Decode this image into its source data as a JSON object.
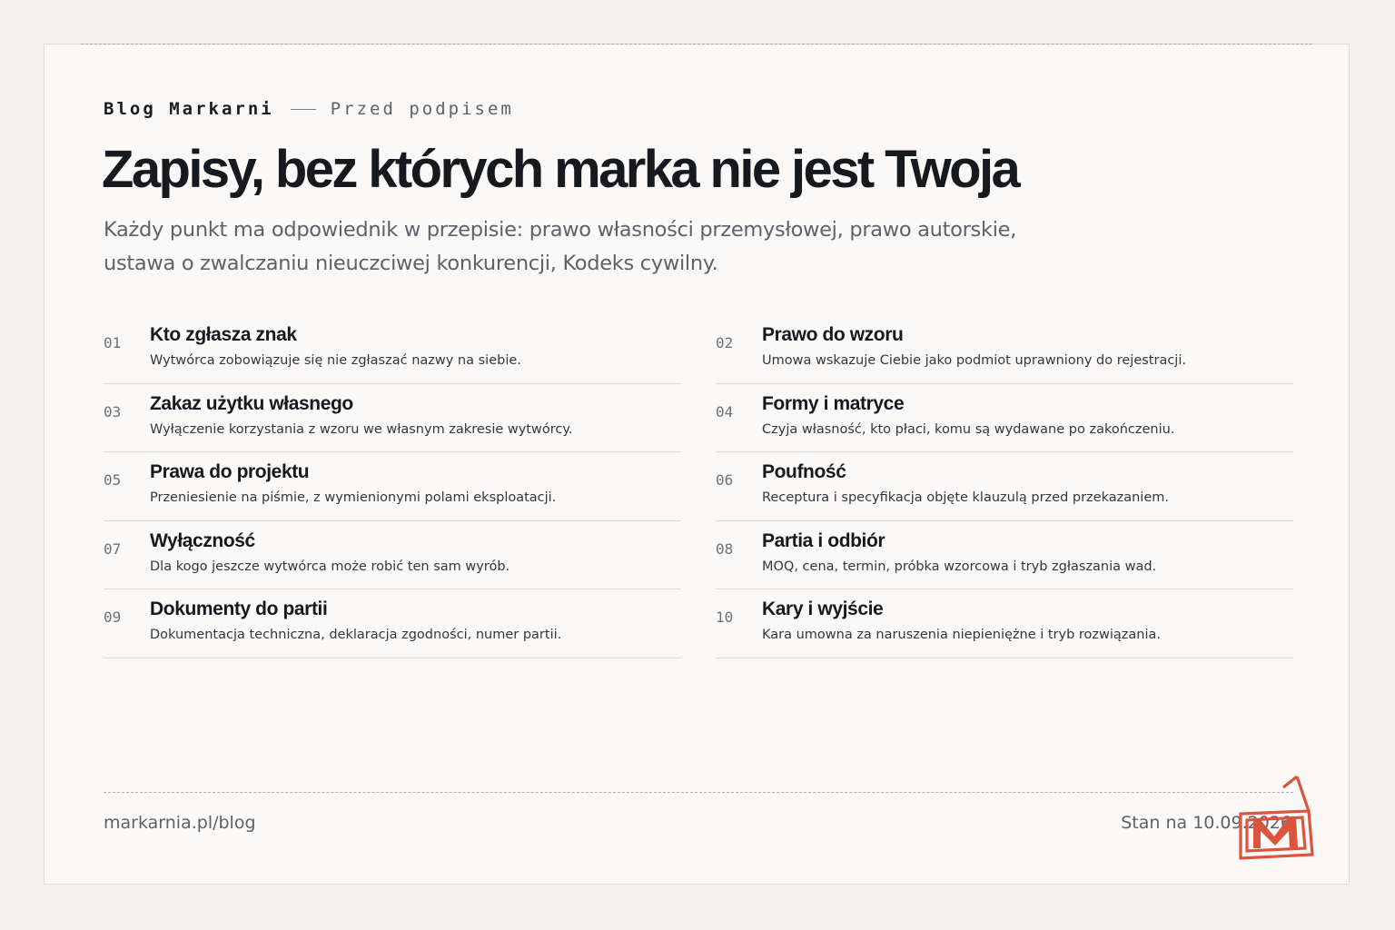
{
  "header": {
    "brand": "Blog Markarni",
    "section": "Przed podpisem",
    "title": "Zapisy, bez których marka nie jest Twoja",
    "lead": "Każdy punkt ma odpowiednik w przepisie: prawo własności przemysłowej, prawo autorskie, ustawa o zwalczaniu nieuczciwej konkurencji, Kodeks cywilny."
  },
  "items": [
    {
      "num": "01",
      "title": "Kto zgłasza znak",
      "desc": "Wytwórca zobowiązuje się nie zgłaszać nazwy na siebie."
    },
    {
      "num": "02",
      "title": "Prawo do wzoru",
      "desc": "Umowa wskazuje Ciebie jako podmiot uprawniony do rejestracji."
    },
    {
      "num": "03",
      "title": "Zakaz użytku własnego",
      "desc": "Wyłączenie korzystania z wzoru we własnym zakresie wytwórcy."
    },
    {
      "num": "04",
      "title": "Formy i matryce",
      "desc": "Czyja własność, kto płaci, komu są wydawane po zakończeniu."
    },
    {
      "num": "05",
      "title": "Prawa do projektu",
      "desc": "Przeniesienie na piśmie, z wymienionymi polami eksploatacji."
    },
    {
      "num": "06",
      "title": "Poufność",
      "desc": "Receptura i specyfikacja objęte klauzulą przed przekazaniem."
    },
    {
      "num": "07",
      "title": "Wyłączność",
      "desc": "Dla kogo jeszcze wytwórca może robić ten sam wyrób."
    },
    {
      "num": "08",
      "title": "Partia i odbiór",
      "desc": "MOQ, cena, termin, próbka wzorcowa i tryb zgłaszania wad."
    },
    {
      "num": "09",
      "title": "Dokumenty do partii",
      "desc": "Dokumentacja techniczna, deklaracja zgodności, numer partii."
    },
    {
      "num": "10",
      "title": "Kary i wyjście",
      "desc": "Kara umowna za naruszenia niepieniężne i tryb rozwiązania."
    }
  ],
  "footer": {
    "link": "markarnia.pl/blog",
    "date": "Stan na 10.09.2026"
  },
  "colors": {
    "accent": "#d9553d",
    "text": "#16191d",
    "muted": "#5e6268",
    "background": "#faf9f7"
  },
  "logo": {
    "icon": "markarnia-m-logo-icon"
  }
}
